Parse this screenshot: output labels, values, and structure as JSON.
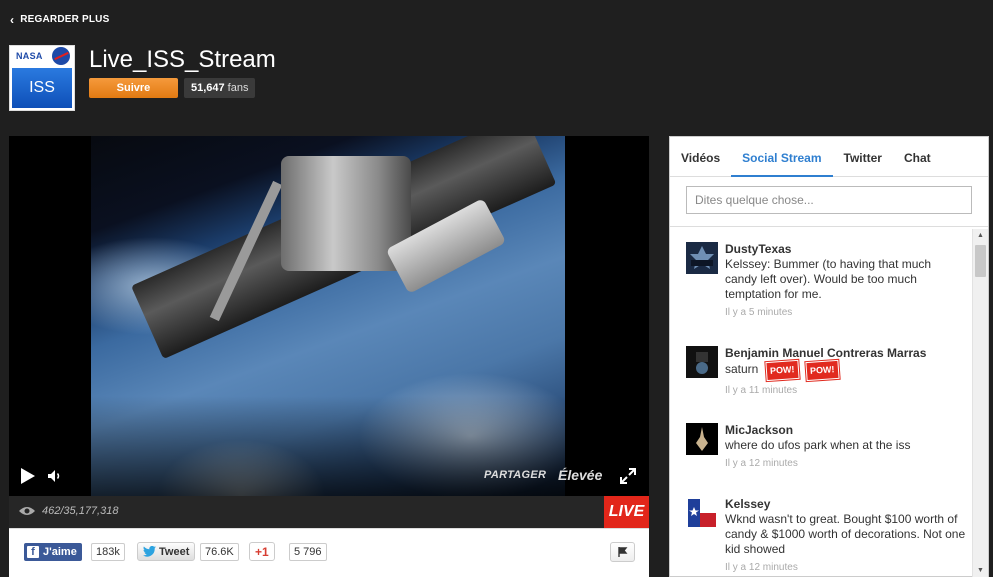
{
  "nav": {
    "back_label": "REGARDER PLUS"
  },
  "channel": {
    "logo_top": "NASA",
    "logo_main": "ISS",
    "title": "Live_ISS_Stream",
    "follow_label": "Suivre",
    "fans_count": "51,647",
    "fans_label": "fans"
  },
  "player": {
    "share_label": "PARTAGER",
    "quality_label": "Élevée",
    "viewers": "462/35,177,318",
    "live_label": "LIVE"
  },
  "social": {
    "fb_label": "J'aime",
    "fb_count": "183k",
    "tweet_label": "Tweet",
    "tweet_count": "76.6K",
    "gplus_label": "+1",
    "gplus_count": "5 796"
  },
  "panel": {
    "tabs": [
      "Vidéos",
      "Social Stream",
      "Twitter",
      "Chat"
    ],
    "active_tab": "Social Stream",
    "input_placeholder": "Dites quelque chose...",
    "posts": [
      {
        "name": "DustyTexas",
        "text": "Kelssey: Bummer (to having that much candy left over). Would be too much temptation for me.",
        "time": "Il y a 5 minutes"
      },
      {
        "name": "Benjamin Manuel Contreras Marras",
        "text": "saturn",
        "stickers": [
          "POW!",
          "POW!"
        ],
        "time": "Il y a 11 minutes"
      },
      {
        "name": "MicJackson",
        "text": "where do ufos park when at the iss",
        "time": "Il y a 12 minutes"
      },
      {
        "name": "Kelssey",
        "text": "Wknd wasn't to great. Bought $100 worth of candy & $1000 worth of decorations. Not one kid showed",
        "time": "Il y a 12 minutes"
      }
    ]
  },
  "colors": {
    "accent": "#2f7fd0",
    "follow": "#f08a24",
    "live": "#e2261a",
    "background": "#1f1f1f"
  }
}
